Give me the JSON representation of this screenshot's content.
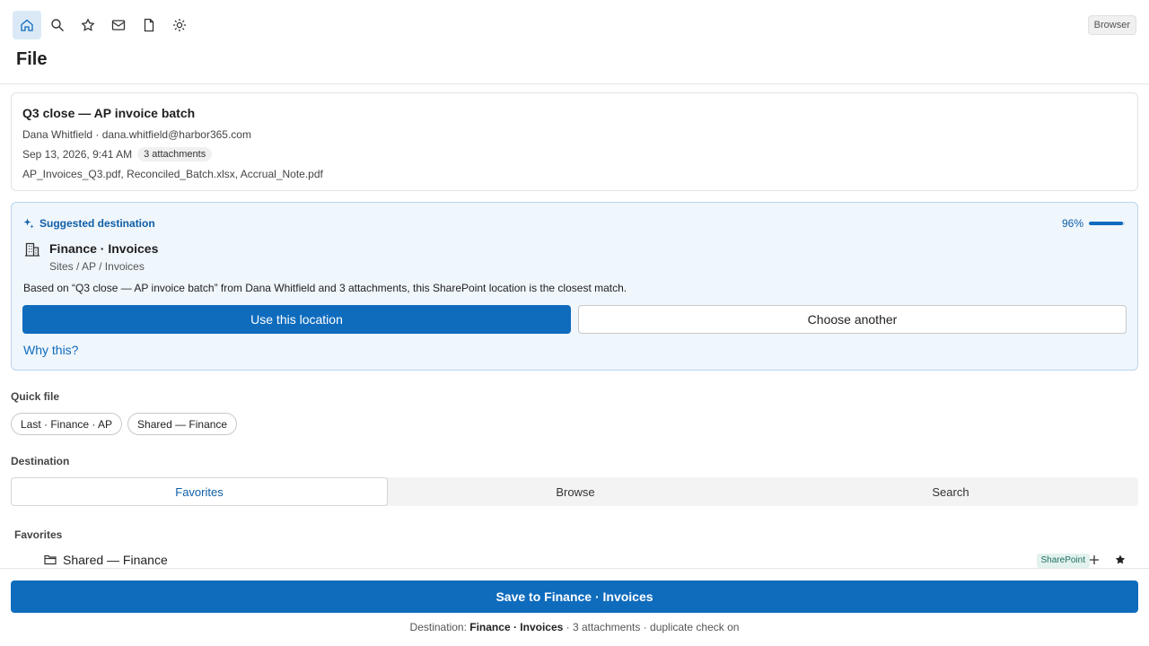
{
  "header": {
    "title": "File",
    "badge": "Browser",
    "nav_icons": [
      "home-icon",
      "search-icon",
      "star-icon",
      "mail-icon",
      "document-icon",
      "settings-icon"
    ]
  },
  "message": {
    "subject": "Q3 close — AP invoice batch",
    "sender": "Dana Whitfield · dana.whitfield@harbor365.com",
    "date": "Sep 13, 2026, 9:41 AM",
    "attachments_badge": "3 attachments",
    "attachment_names": "AP_Invoices_Q3.pdf, Reconciled_Batch.xlsx, Accrual_Note.pdf"
  },
  "suggestion": {
    "heading": "Suggested destination",
    "confidence": "96%",
    "confidence_value": 0.96,
    "destination_name": "Finance · Invoices",
    "destination_path": "Sites / AP / Invoices",
    "reason": "Based on “Q3 close — AP invoice batch” from Dana Whitfield and 3 attachments, this SharePoint location is the closest match.",
    "use_label": "Use this location",
    "choose_label": "Choose another",
    "why_label": "Why this?"
  },
  "quick_file": {
    "label": "Quick file",
    "chips": [
      "Last · Finance · AP",
      "Shared — Finance"
    ]
  },
  "destination": {
    "label": "Destination",
    "tabs": [
      "Favorites",
      "Browse",
      "Search"
    ],
    "active_tab": "Favorites",
    "section_label": "Favorites",
    "items": [
      {
        "name": "Shared — Finance",
        "badge": "SharePoint"
      }
    ]
  },
  "footer": {
    "save_label": "Save to Finance · Invoices",
    "note_prefix": "Destination:",
    "note_dest": "Finance · Invoices",
    "note_suffix": "· 3 attachments · duplicate check on"
  },
  "colors": {
    "accent": "#0f6cbd",
    "suggest_bg": "#eff6fc",
    "suggest_border": "#b9d4ee"
  }
}
